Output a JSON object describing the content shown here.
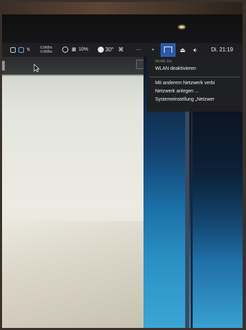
{
  "menubar": {
    "net_up": "0.0KB/s",
    "net_down": "0.0KB/s",
    "cpu_percent": "10%",
    "temperature": "30°",
    "battery_extra": "⌘",
    "clock": "Di. 21:19"
  },
  "wifi_menu": {
    "status_label": "WLAN: Ein",
    "toggle_label": "WLAN deaktivieren",
    "items": [
      "Mit anderem Netzwerk verbi",
      "Netzwerk anlegen ...",
      "Systemeinstellung „Netzwer"
    ]
  },
  "colors": {
    "menubar_bg": "#1f1f22",
    "wifi_highlight": "#2d5aa8",
    "menu_bg": "#202022"
  },
  "icons": [
    "dropbox-icon",
    "sync-icon",
    "eject-icon",
    "dot-icon",
    "more-icon",
    "airplay-icon",
    "eject-icon-2",
    "volume-icon",
    "cursor-icon"
  ]
}
